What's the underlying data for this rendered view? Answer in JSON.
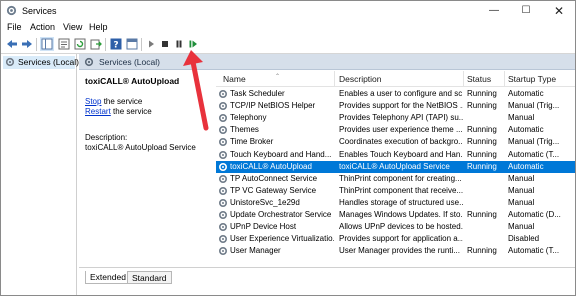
{
  "window": {
    "title": "Services",
    "minimize": "—",
    "maximize": "☐",
    "close": "✕"
  },
  "menu": [
    "File",
    "Action",
    "View",
    "Help"
  ],
  "toolbar": {
    "buttons": [
      "back-icon",
      "forward-icon",
      "show-tree-icon",
      "properties-icon",
      "refresh-icon",
      "export-icon",
      "help-icon",
      "console-icon",
      "start-icon",
      "stop-icon",
      "pause-icon",
      "restart-icon"
    ]
  },
  "tree": {
    "item": "Services (Local)"
  },
  "pane": {
    "header": "Services (Local)"
  },
  "details": {
    "title": "toxiCALL® AutoUpload",
    "stop_link": "Stop",
    "stop_rest": " the service",
    "restart_link": "Restart",
    "restart_rest": " the service",
    "description_label": "Description:",
    "description_text": "toxiCALL® AutoUpload Service"
  },
  "columns": {
    "name": "Name",
    "description": "Description",
    "status": "Status",
    "startup": "Startup Type"
  },
  "rows": [
    {
      "name": "Task Scheduler",
      "description": "Enables a user to configure and sc...",
      "status": "Running",
      "startup": "Automatic"
    },
    {
      "name": "TCP/IP NetBIOS Helper",
      "description": "Provides support for the NetBIOS ...",
      "status": "Running",
      "startup": "Manual (Trig..."
    },
    {
      "name": "Telephony",
      "description": "Provides Telephony API (TAPI) su...",
      "status": "",
      "startup": "Manual"
    },
    {
      "name": "Themes",
      "description": "Provides user experience theme ...",
      "status": "Running",
      "startup": "Automatic"
    },
    {
      "name": "Time Broker",
      "description": "Coordinates execution of backgro...",
      "status": "Running",
      "startup": "Manual (Trig..."
    },
    {
      "name": "Touch Keyboard and Hand...",
      "description": "Enables Touch Keyboard and Han...",
      "status": "Running",
      "startup": "Automatic (T..."
    },
    {
      "name": "toxiCALL® AutoUpload",
      "description": "toxiCALL® AutoUpload Service",
      "status": "Running",
      "startup": "Automatic"
    },
    {
      "name": "TP AutoConnect Service",
      "description": "ThinPrint component for creating...",
      "status": "",
      "startup": "Manual"
    },
    {
      "name": "TP VC Gateway Service",
      "description": "ThinPrint component that receive...",
      "status": "",
      "startup": "Manual"
    },
    {
      "name": "UnistoreSvc_1e29d",
      "description": "Handles storage of structured use...",
      "status": "",
      "startup": "Manual"
    },
    {
      "name": "Update Orchestrator Service",
      "description": "Manages Windows Updates. If sto...",
      "status": "Running",
      "startup": "Automatic (D..."
    },
    {
      "name": "UPnP Device Host",
      "description": "Allows UPnP devices to be hosted...",
      "status": "",
      "startup": "Manual"
    },
    {
      "name": "User Experience Virtualizatio...",
      "description": "Provides support for application a...",
      "status": "",
      "startup": "Disabled"
    },
    {
      "name": "User Manager",
      "description": "User Manager provides the runti...",
      "status": "Running",
      "startup": "Automatic (T..."
    }
  ],
  "selected_row_index": 6,
  "tabs": [
    "Extended",
    "Standard"
  ],
  "colors": {
    "selection": "#0078d7",
    "header_band": "#d6dfea",
    "annotation_arrow": "#e8323c"
  }
}
